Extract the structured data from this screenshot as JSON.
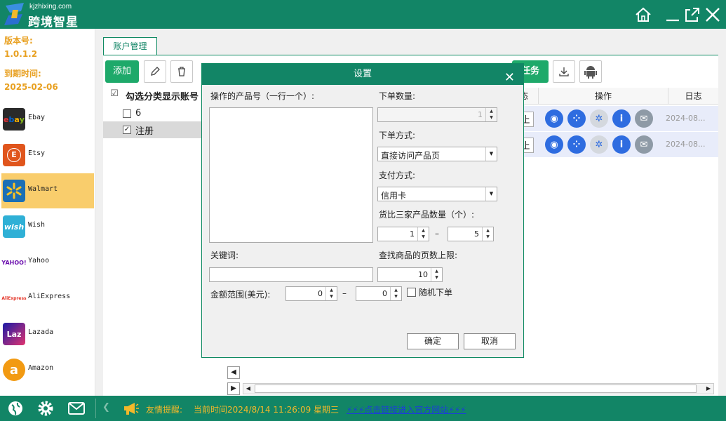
{
  "app": {
    "logo_url": "kjzhixing.com",
    "logo_name": "跨境智星"
  },
  "sidebar": {
    "version_label": "版本号:",
    "version_value": "1.0.1.2",
    "expire_label": "到期时间:",
    "expire_value": "2025-02-06",
    "platforms": [
      {
        "name": "Ebay",
        "icon": "ebay-icon",
        "color": "#2a2a2a"
      },
      {
        "name": "Etsy",
        "icon": "etsy-icon",
        "color": "#e0551c"
      },
      {
        "name": "Walmart",
        "icon": "walmart-icon",
        "color": "#1b6fb5"
      },
      {
        "name": "Wish",
        "icon": "wish-icon",
        "color": "#2fb0d6"
      },
      {
        "name": "Yahoo",
        "icon": "yahoo-icon",
        "color": "#6b0fae"
      },
      {
        "name": "AliExpress",
        "icon": "aliexpress-icon",
        "color": "#e43225"
      },
      {
        "name": "Lazada",
        "icon": "lazada-icon",
        "color": "#e0336f"
      },
      {
        "name": "Amazon",
        "icon": "amazon-icon",
        "color": "#f29a12"
      }
    ],
    "active_platform": "Walmart"
  },
  "main": {
    "tab_label": "账户管理",
    "add_button": "添加",
    "task_button": "任务",
    "account_header": "勾选分类显示账号",
    "accounts": [
      {
        "label": "6",
        "checked": false
      },
      {
        "label": "注册",
        "checked": true
      }
    ],
    "grid_headers": {
      "status": "态",
      "actions": "操作",
      "log": "日志"
    },
    "rows": [
      {
        "status": "止",
        "log": "2024-08..."
      },
      {
        "status": "止",
        "log": "2024-08..."
      }
    ]
  },
  "dialog": {
    "title": "设置",
    "product_label": "操作的产品号（一行一个）:",
    "qty_label": "下单数量:",
    "qty_value": "1",
    "order_method_label": "下单方式:",
    "order_method_value": "直接访问产品页",
    "payment_label": "支付方式:",
    "payment_value": "信用卡",
    "compare_label": "货比三家产品数量（个）:",
    "compare_min": "1",
    "compare_max": "5",
    "range_dash": "–",
    "keyword_label": "关键词:",
    "page_limit_label": "查找商品的页数上限:",
    "page_limit_value": "10",
    "amount_label": "金额范围(美元):",
    "amount_min": "0",
    "amount_max": "0",
    "random_label": "随机下单",
    "ok_button": "确定",
    "cancel_button": "取消"
  },
  "statusbar": {
    "tip_label": "友情提醒:",
    "time_text": "当前时间2024/8/14  11:26:09 星期三",
    "link_text": "⚡⚡⚡点击链接进入官方网站⚡⚡⚡"
  },
  "colors": {
    "brand": "#128566",
    "accent": "#1ea96a",
    "highlight": "#f9cd6c",
    "label_orange": "#e8a020"
  }
}
